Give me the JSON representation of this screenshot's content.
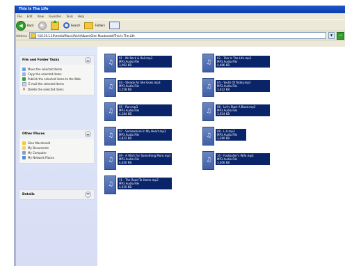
{
  "window": {
    "title": "This Is The Life"
  },
  "menu": [
    "File",
    "Edit",
    "View",
    "Favorites",
    "Tools",
    "Help"
  ],
  "toolbar": {
    "back": "Back",
    "search": "Search",
    "folders": "Folders"
  },
  "address": {
    "label": "Address",
    "path": "\\\\10.10.1.10\\media\\Music\\Rich\\Album\\Glen Macdonald\\This Is The Life",
    "go": "Go"
  },
  "tasks_panel": {
    "title": "File and Folder Tasks",
    "items": [
      "Move the selected items",
      "Copy the selected items",
      "Publish the selected items to the Web",
      "E-mail the selected items",
      "Delete the selected items"
    ]
  },
  "places_panel": {
    "title": "Other Places",
    "items": [
      "Glen Macdonald",
      "My Documents",
      "My Computer",
      "My Network Places"
    ]
  },
  "details_panel": {
    "title": "Details"
  },
  "files": [
    {
      "name": "01 - Mr Rock & Roll.mp3",
      "type": "MP3 Audio File",
      "size": "3,992 KB"
    },
    {
      "name": "02 - This Is The Life.mp3",
      "type": "MP3 Audio File",
      "size": "4,486 KB"
    },
    {
      "name": "03 - Steady As She Goes.mp3",
      "type": "MP3 Audio File",
      "size": "3,558 KB"
    },
    {
      "name": "04 - Youth Of Today.mp3",
      "type": "MP3 Audio File",
      "size": "3,612 KB"
    },
    {
      "name": "05 - Run.mp3",
      "type": "MP3 Audio File",
      "size": "4,184 KB"
    },
    {
      "name": "06 - Let's Start A Band.mp3",
      "type": "MP3 Audio File",
      "size": "3,924 KB"
    },
    {
      "name": "07 - Somewhere In My Heart.mp3",
      "type": "MP3 Audio File",
      "size": "3,812 KB"
    },
    {
      "name": "08 - L.A.mp3",
      "type": "MP3 Audio File",
      "size": "3,280 KB"
    },
    {
      "name": "09 - A Wish For Something More.mp3",
      "type": "MP3 Audio File",
      "size": "4,020 KB"
    },
    {
      "name": "10 - Footballer's Wife.mp3",
      "type": "MP3 Audio File",
      "size": "3,406 KB"
    },
    {
      "name": "11 - The Road To Home.mp3",
      "type": "MP3 Audio File",
      "size": "4,910 KB"
    }
  ]
}
